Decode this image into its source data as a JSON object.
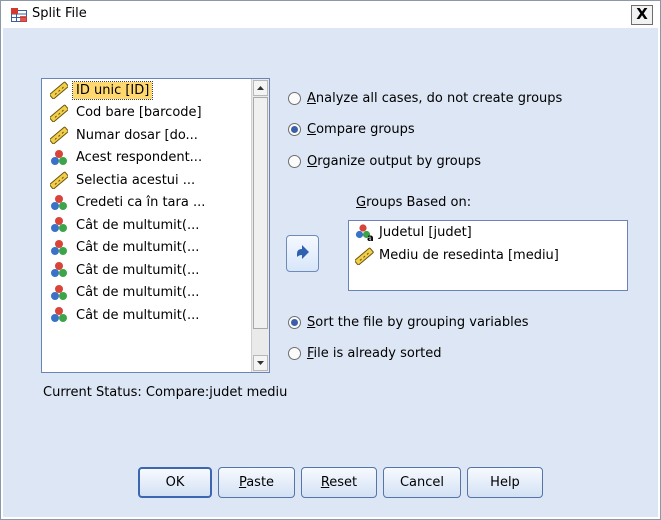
{
  "window": {
    "title": "Split File",
    "close_label": "X"
  },
  "variables": [
    {
      "label": "ID unic [ID]",
      "icon": "ruler-icon",
      "selected": true
    },
    {
      "label": "Cod bare [barcode]",
      "icon": "ruler-icon"
    },
    {
      "label": "Numar dosar [do...",
      "icon": "ruler-icon"
    },
    {
      "label": "Acest respondent...",
      "icon": "nominal-icon"
    },
    {
      "label": "Selectia acestui ...",
      "icon": "ruler-icon"
    },
    {
      "label": "Credeti ca în tara ...",
      "icon": "nominal-icon"
    },
    {
      "label": "Cât de multumit(...",
      "icon": "nominal-icon"
    },
    {
      "label": "Cât de multumit(...",
      "icon": "nominal-icon"
    },
    {
      "label": "Cât de multumit(...",
      "icon": "nominal-icon"
    },
    {
      "label": "Cât de multumit(...",
      "icon": "nominal-icon"
    },
    {
      "label": "Cât de multumit(...",
      "icon": "nominal-icon"
    }
  ],
  "options": {
    "analyze_all": {
      "label": "Analyze all cases, do not create groups",
      "checked": false
    },
    "compare_groups": {
      "label": "Compare groups",
      "checked": true
    },
    "organize_output": {
      "label": "Organize output by groups",
      "checked": false
    }
  },
  "groups": {
    "label": "Groups Based on:",
    "items": [
      {
        "label": "Judetul [judet]",
        "icon": "nominal-string-icon"
      },
      {
        "label": "Mediu de resedinta [mediu]",
        "icon": "ruler-icon"
      }
    ]
  },
  "sort": {
    "sort_by_grouping": {
      "label": "Sort the file by grouping variables",
      "checked": true
    },
    "already_sorted": {
      "label": "File is already sorted",
      "checked": false
    }
  },
  "status": {
    "text": "Current Status: Compare:judet mediu"
  },
  "buttons": {
    "ok": "OK",
    "paste": "Paste",
    "reset": "Reset",
    "cancel": "Cancel",
    "help": "Help"
  },
  "colors": {
    "dialog_bg": "#dce6f4",
    "selection": "#ffd970",
    "radio_dot": "#3b5fa8"
  }
}
